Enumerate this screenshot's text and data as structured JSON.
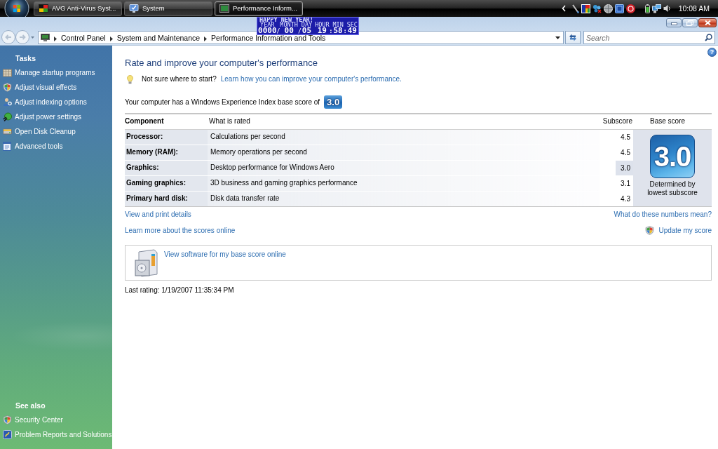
{
  "taskbar": {
    "tasks": [
      {
        "label": "AVG Anti-Virus Syst...",
        "selected": false
      },
      {
        "label": "System",
        "selected": false
      },
      {
        "label": "Performance Inform...",
        "selected": true
      }
    ],
    "clock": "10:08 AM"
  },
  "clock_widget": {
    "greeting": "HAPPY NEW YEAR!",
    "fields": [
      {
        "label": "YEAR",
        "value": "0000",
        "separator": "/"
      },
      {
        "label": "MONTH",
        "value": "00",
        "separator": "/"
      },
      {
        "label": "DAY",
        "value": "05"
      },
      {
        "label": "HOUR",
        "value": "19",
        "separator": ":"
      },
      {
        "label": "MIN",
        "value": "58",
        "separator": ":"
      },
      {
        "label": "SEC",
        "value": "49"
      }
    ]
  },
  "address_bar": {
    "breadcrumbs": [
      "Control Panel",
      "System and Maintenance",
      "Performance Information and Tools"
    ]
  },
  "search": {
    "placeholder": "Search"
  },
  "sidebar": {
    "sections": [
      {
        "heading": "Tasks",
        "items": [
          "Manage startup programs",
          "Adjust visual effects",
          "Adjust indexing options",
          "Adjust power settings",
          "Open Disk Cleanup",
          "Advanced tools"
        ]
      },
      {
        "heading": "See also",
        "items": [
          "Security Center",
          "Problem Reports and Solutions"
        ]
      }
    ]
  },
  "main": {
    "help": "?",
    "title": "Rate and improve your computer's performance",
    "tip": {
      "text": "Not sure where to start?",
      "link": "Learn how you can improve your computer's performance."
    },
    "score_sentence": "Your computer has a Windows Experience Index base score of",
    "score_badge": "3.0",
    "table": {
      "columns": [
        "Component",
        "What is rated",
        "Subscore",
        "Base score"
      ],
      "rows": [
        {
          "component": "Processor:",
          "rated": "Calculations per second",
          "subscore": "4.5",
          "lowest": false
        },
        {
          "component": "Memory (RAM):",
          "rated": "Memory operations per second",
          "subscore": "4.5",
          "lowest": false
        },
        {
          "component": "Graphics:",
          "rated": "Desktop performance for Windows Aero",
          "subscore": "3.0",
          "lowest": true
        },
        {
          "component": "Gaming graphics:",
          "rated": "3D business and gaming graphics performance",
          "subscore": "3.1",
          "lowest": false
        },
        {
          "component": "Primary hard disk:",
          "rated": "Disk data transfer rate",
          "subscore": "4.3",
          "lowest": false
        }
      ],
      "base_score": {
        "score": "3.0",
        "note": "Determined by lowest subscore"
      }
    },
    "link_rows": [
      {
        "left": "View and print details",
        "right": "What do these numbers mean?"
      },
      {
        "left": "Learn more about the scores online",
        "right": "Update my score"
      }
    ],
    "software_panel": {
      "link": "View software for my base score online"
    },
    "last_rating": "Last rating: 1/19/2007 11:35:34 PM"
  }
}
